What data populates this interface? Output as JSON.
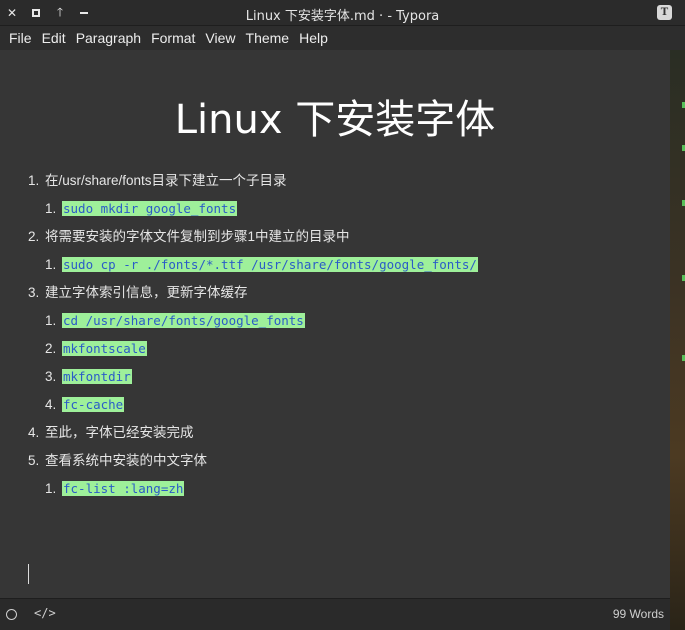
{
  "window": {
    "title": "Linux 下安装字体.md · - Typora",
    "app_icon_letter": "T",
    "controls": [
      "close",
      "maximize",
      "up",
      "minimize"
    ]
  },
  "menu": [
    "File",
    "Edit",
    "Paragraph",
    "Format",
    "View",
    "Theme",
    "Help"
  ],
  "document": {
    "title": "Linux 下安装字体",
    "steps": [
      {
        "num": "1.",
        "text": "在/usr/share/fonts目录下建立一个子目录",
        "sub": [
          {
            "num": "1.",
            "code": "sudo mkdir google_fonts"
          }
        ]
      },
      {
        "num": "2.",
        "text": "将需要安装的字体文件复制到步骤1中建立的目录中",
        "sub": [
          {
            "num": "1.",
            "code": "sudo cp -r ./fonts/*.ttf /usr/share/fonts/google_fonts/"
          }
        ]
      },
      {
        "num": "3.",
        "text": "建立字体索引信息，更新字体缓存",
        "sub": [
          {
            "num": "1.",
            "code": "cd /usr/share/fonts/google_fonts"
          },
          {
            "num": "2.",
            "code": "mkfontscale"
          },
          {
            "num": "3.",
            "code": "mkfontdir"
          },
          {
            "num": "4.",
            "code": "fc-cache"
          }
        ]
      },
      {
        "num": "4.",
        "text": "至此，字体已经安装完成",
        "sub": []
      },
      {
        "num": "5.",
        "text": "查看系统中安装的中文字体",
        "sub": [
          {
            "num": "1.",
            "code": "fc-list :lang=zh"
          }
        ]
      }
    ]
  },
  "status": {
    "word_count": "99 Words",
    "source_toggle": "</>"
  },
  "colors": {
    "code_bg": "#9ef09a",
    "code_fg": "#2b5cc7",
    "editor_bg": "#363636"
  }
}
